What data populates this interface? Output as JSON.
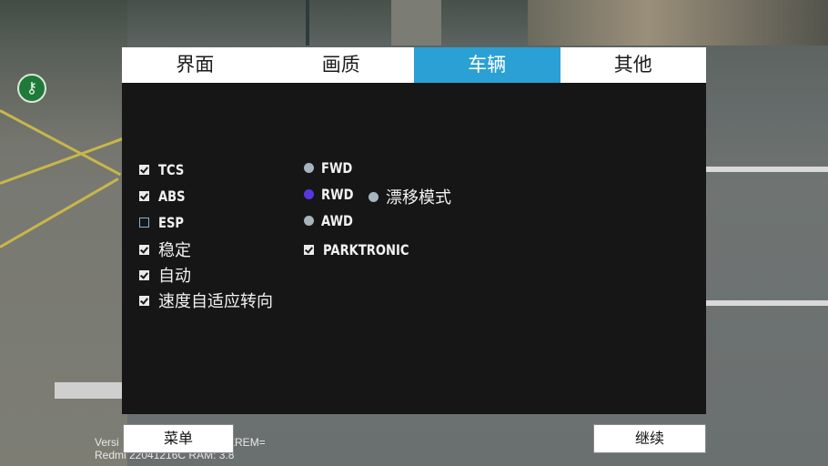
{
  "tabs": [
    "界面",
    "画质",
    "车辆",
    "其他"
  ],
  "active_tab": "车辆",
  "checkboxes": [
    {
      "label": "TCS",
      "checked": true
    },
    {
      "label": "ABS",
      "checked": true
    },
    {
      "label": "ESP",
      "checked": false
    },
    {
      "label": "稳定",
      "checked": true
    },
    {
      "label": "自动",
      "checked": true
    },
    {
      "label": "速度自适应转向",
      "checked": true
    }
  ],
  "drive": [
    {
      "label": "FWD",
      "selected": false
    },
    {
      "label": "RWD",
      "selected": true
    },
    {
      "label": "AWD",
      "selected": false
    }
  ],
  "drift": {
    "label": "漂移模式",
    "selected": false
  },
  "parktronic": {
    "label": "PARKTRONIC",
    "checked": true
  },
  "buttons": {
    "menu": "菜单",
    "continue": "继续"
  },
  "version": {
    "line1_left": "Versi",
    "line1_right": "ZREM=",
    "line2": "Redmi 22041216C RAM: 3.8"
  },
  "icons": {
    "floating": "wrench-lock-icon"
  },
  "colors": {
    "tab_active": "#2ba0d5",
    "radio_selected": "#5a36e0",
    "panel_bg": "#161616"
  }
}
